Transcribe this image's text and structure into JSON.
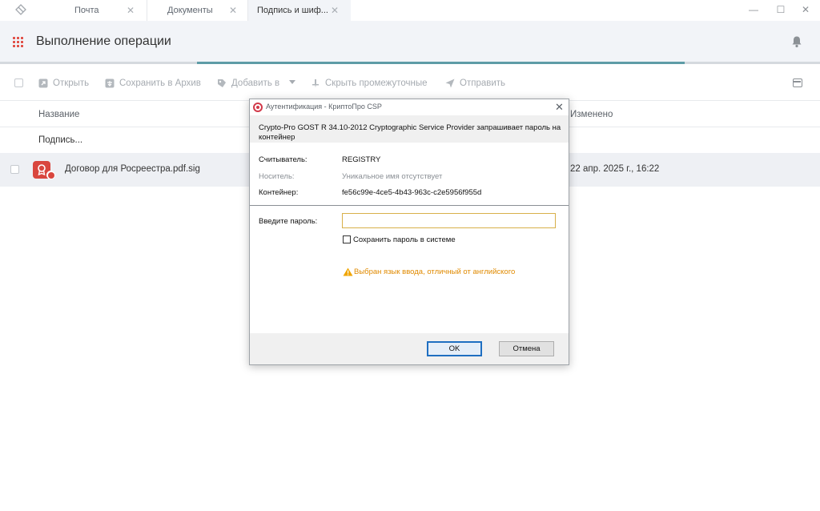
{
  "tabs": [
    {
      "label": "Почта"
    },
    {
      "label": "Документы"
    },
    {
      "label": "Подпись и шиф..."
    }
  ],
  "tab_close_glyph": "✕",
  "window_controls": {
    "minimize": "—",
    "maximize": "☐",
    "close": "✕"
  },
  "header": {
    "title": "Выполнение операции",
    "progress_fraction": 0.835
  },
  "toolbar": {
    "open": "Открыть",
    "save_archive": "Сохранить в Архив",
    "add_to": "Добавить в",
    "hide_intermediate": "Скрыть промежуточные",
    "send": "Отправить"
  },
  "table": {
    "col_name": "Название",
    "col_modified": "Изменено",
    "group_label": "Подпись...",
    "rows": [
      {
        "name": "Договор для Росреестра.pdf.sig",
        "modified": "22 апр. 2025 г., 16:22"
      }
    ]
  },
  "dialog": {
    "title": "Аутентификация - КриптоПро CSP",
    "close_glyph": "✕",
    "message": "Crypto-Pro GOST R 34.10-2012 Cryptographic Service Provider запрашивает пароль на контейнер",
    "reader_label": "Считыватель:",
    "reader_value": "REGISTRY",
    "media_label": "Носитель:",
    "media_value": "Уникальное имя отсутствует",
    "container_label": "Контейнер:",
    "container_value": "fe56c99e-4ce5-4b43-963c-c2e5956f955d",
    "password_label": "Введите пароль:",
    "password_value": "",
    "save_password_label": "Сохранить пароль в системе",
    "warning": "Выбран язык ввода, отличный от английского",
    "ok": "OK",
    "cancel": "Отмена"
  },
  "colors": {
    "accent": "#5e9ca6",
    "brand_red": "#d9463e",
    "warning": "#e08a00",
    "ok_border": "#1f6fc1"
  }
}
